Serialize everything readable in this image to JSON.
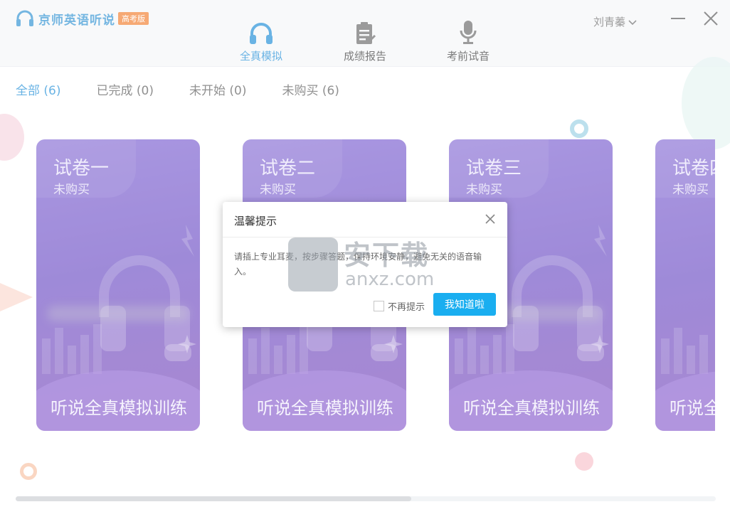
{
  "app": {
    "name": "京师英语听说",
    "badge": "高考版",
    "user": "刘青蓁",
    "accent": "#1a8ad6"
  },
  "nav": [
    {
      "label": "全真模拟",
      "icon": "headphones-icon",
      "active": true
    },
    {
      "label": "成绩报告",
      "icon": "report-icon",
      "active": false
    },
    {
      "label": "考前试音",
      "icon": "microphone-icon",
      "active": false
    }
  ],
  "filters": [
    {
      "label": "全部 (6)",
      "active": true
    },
    {
      "label": "已完成 (0)",
      "active": false
    },
    {
      "label": "未开始 (0)",
      "active": false
    },
    {
      "label": "未购买 (6)",
      "active": false
    }
  ],
  "cards": [
    {
      "title": "试卷一",
      "status": "未购买",
      "caption": "听说全真模拟训练"
    },
    {
      "title": "试卷二",
      "status": "未购买",
      "caption": "听说全真模拟训练"
    },
    {
      "title": "试卷三",
      "status": "未购买",
      "caption": "听说全真模拟训练"
    },
    {
      "title": "试卷四",
      "status": "未购买",
      "caption": "听说全真模拟训练"
    }
  ],
  "dialog": {
    "title": "温馨提示",
    "message": "请插上专业耳麦，按步骤答题，保持环境安静，避免无关的语音输入。",
    "checkbox_label": "不再提示",
    "button_label": "我知道啦",
    "button_color": "#1aaef0"
  },
  "watermark": {
    "cn": "安下载",
    "en": "anxz.com"
  }
}
